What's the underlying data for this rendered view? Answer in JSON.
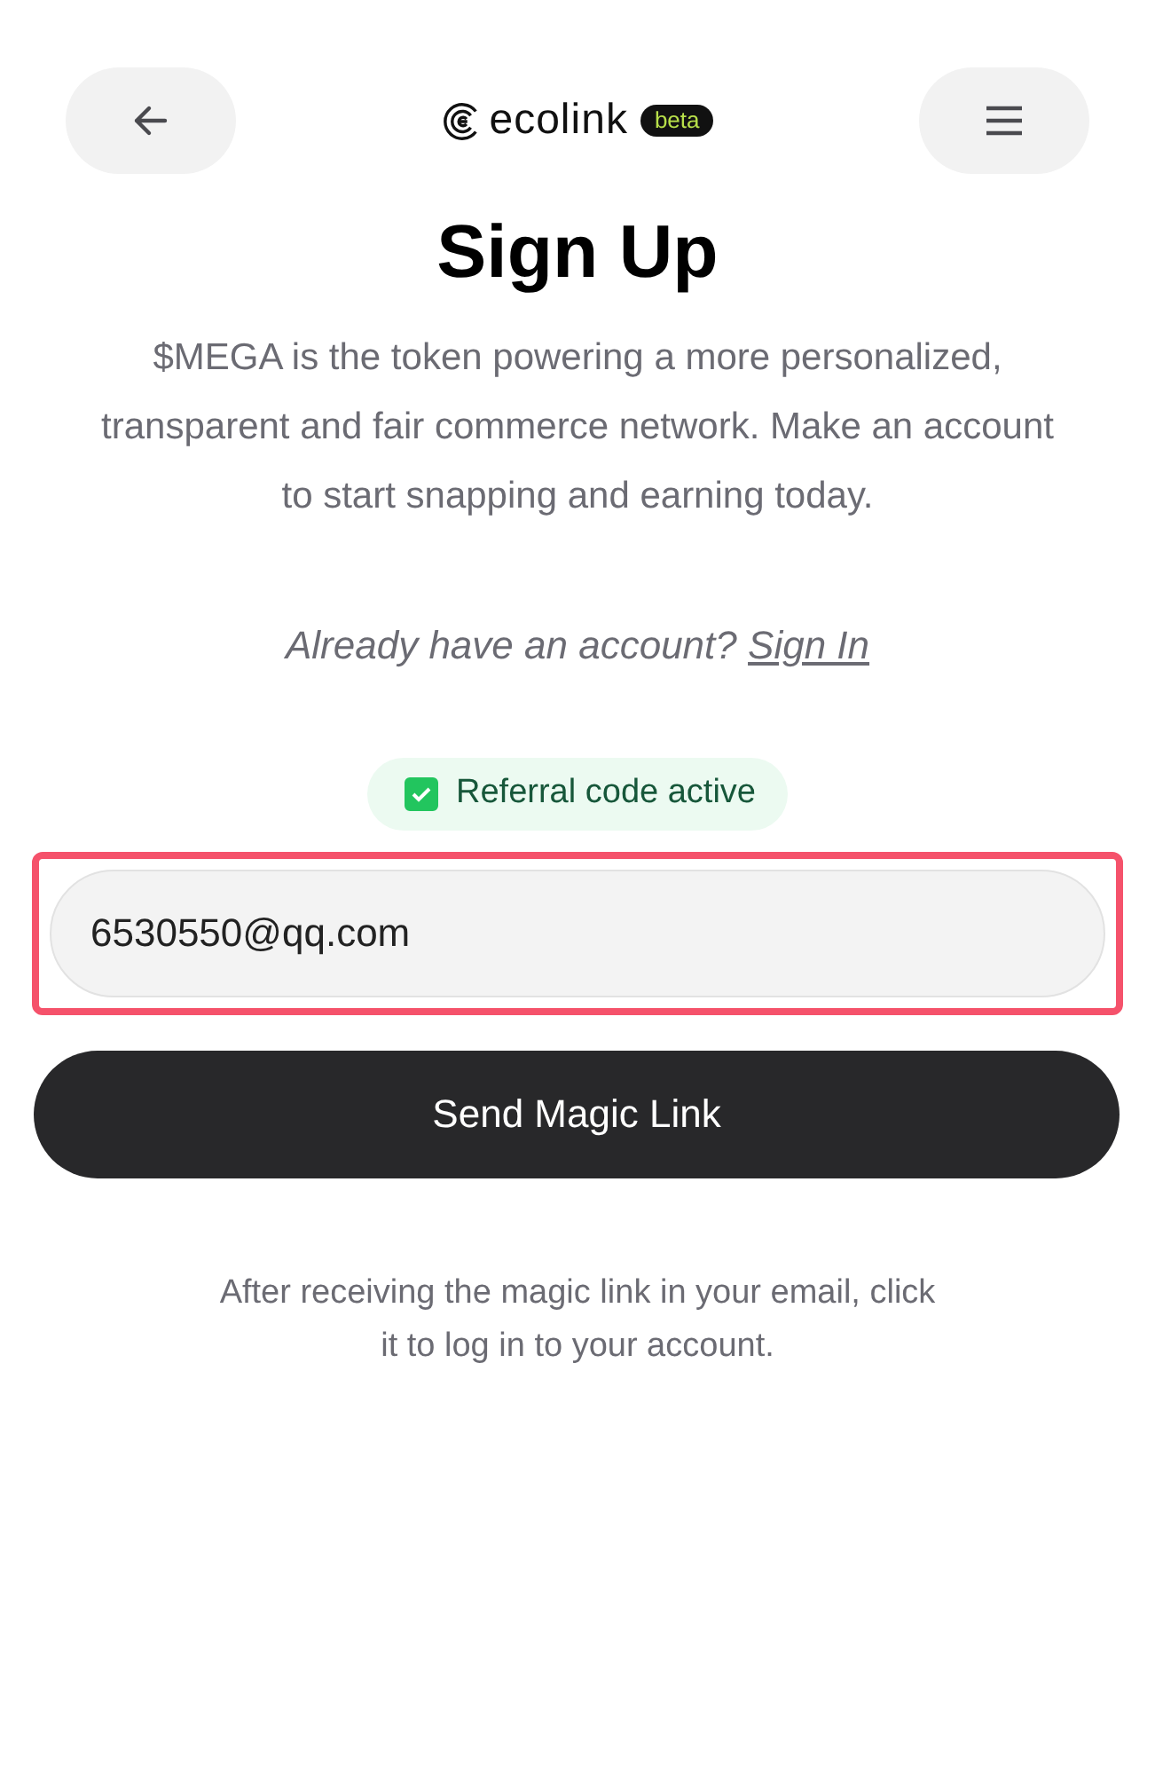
{
  "header": {
    "brand": "ecolink",
    "badge": "beta"
  },
  "title": "Sign Up",
  "intro": "$MEGA is the token powering a more personalized, transparent and fair commerce network. Make an account to start snapping and earning today.",
  "signin": {
    "prompt": "Already have an account?",
    "link": "Sign In"
  },
  "referral": {
    "label": "Referral code active",
    "checked": true
  },
  "email": {
    "value": "6530550@qq.com",
    "highlighted": true
  },
  "submit": "Send Magic Link",
  "note": "After receiving the magic link in your email, click it to log in to your account."
}
